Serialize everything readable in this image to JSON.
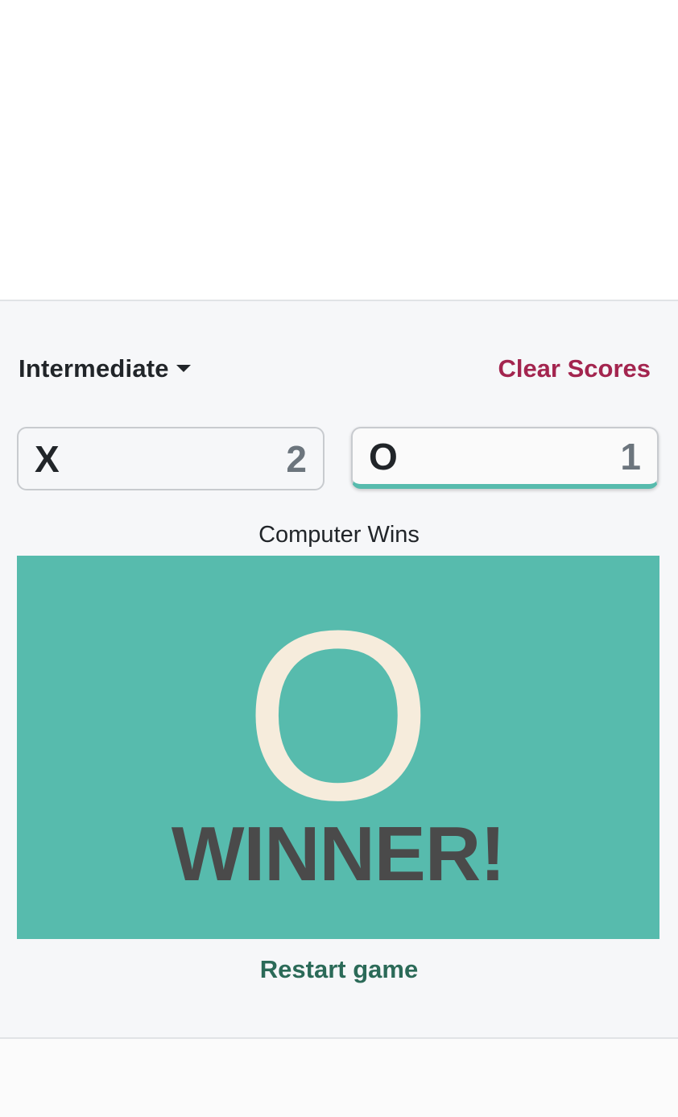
{
  "controls": {
    "difficulty_label": "Intermediate",
    "clear_scores_label": "Clear Scores"
  },
  "scores": {
    "x": {
      "symbol": "X",
      "score": "2"
    },
    "o": {
      "symbol": "O",
      "score": "1",
      "active": true
    }
  },
  "status": "Computer Wins",
  "board": {
    "winner_symbol": "O",
    "winner_text": "WINNER!"
  },
  "restart_label": "Restart game",
  "colors": {
    "accent": "#57bbad",
    "clear_scores": "#a3254f",
    "restart": "#2b6a58",
    "winner_symbol": "#f6ecdc",
    "winner_text": "#4a4a4a"
  },
  "icons": {
    "difficulty_dropdown": "chevron-down-icon"
  }
}
